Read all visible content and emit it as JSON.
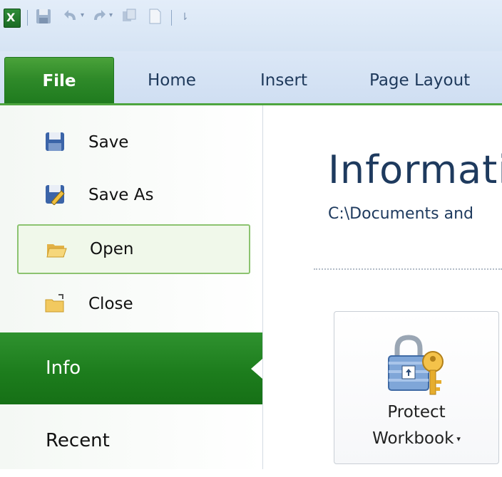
{
  "quick_access": {
    "app_icon": "excel-icon",
    "items": [
      "save-icon",
      "undo-icon",
      "redo-icon",
      "copy-icon",
      "new-document-icon",
      "customize-icon"
    ]
  },
  "ribbon": {
    "tabs": [
      {
        "label": "File",
        "active": true
      },
      {
        "label": "Home"
      },
      {
        "label": "Insert"
      },
      {
        "label": "Page Layout"
      }
    ]
  },
  "backstage": {
    "commands": [
      {
        "label": "Save",
        "icon": "save-icon"
      },
      {
        "label": "Save As",
        "icon": "save-as-icon"
      },
      {
        "label": "Open",
        "icon": "open-folder-icon",
        "hovered": true
      },
      {
        "label": "Close",
        "icon": "close-folder-icon"
      }
    ],
    "nav": [
      {
        "label": "Info",
        "selected": true
      },
      {
        "label": "Recent"
      }
    ]
  },
  "info": {
    "title": "Information",
    "path": "C:\\Documents and"
  },
  "protect": {
    "line1": "Protect",
    "line2": "Workbook",
    "icon": "lock-key-icon"
  },
  "colors": {
    "file_tab": "#2f8a29",
    "nav_selected": "#1d7d1d",
    "title_text": "#1e3a5e",
    "ribbon_bg": "#d6e4f4"
  }
}
